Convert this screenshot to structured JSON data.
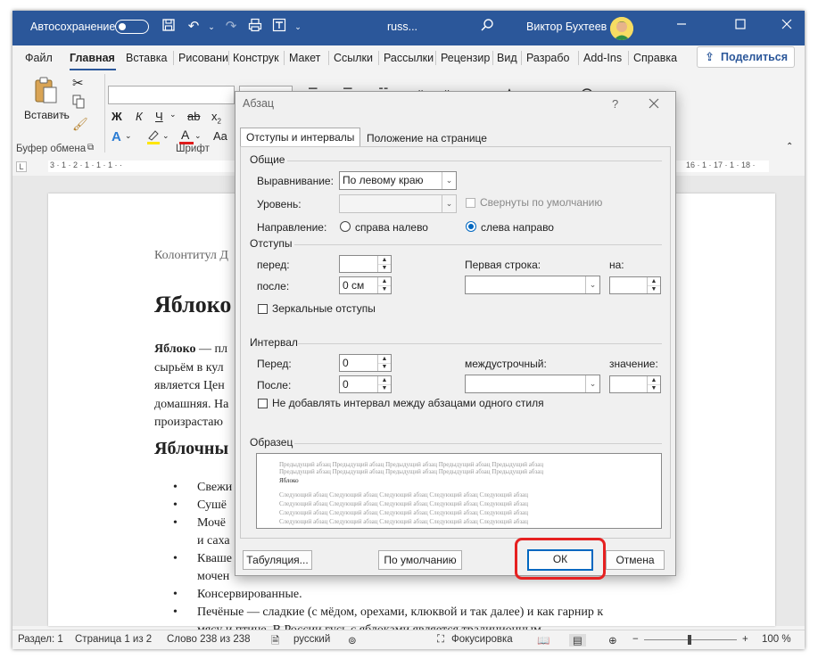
{
  "titlebar": {
    "autosave_label": "Автосохранение",
    "doc_name": "russ...",
    "user_name": "Виктор Бухтеев"
  },
  "tabs": [
    "Файл",
    "Главная",
    "Вставка",
    "Рисовани",
    "Конструк",
    "Макет",
    "Ссылки",
    "Рассылки",
    "Рецензир",
    "Вид",
    "Разрабо",
    "Add-Ins",
    "Справка"
  ],
  "share_label": "Поделиться",
  "ribbon": {
    "paste_label": "Вставить",
    "clipboard_group": "Буфер обмена",
    "font_group": "Шрифт",
    "bold": "Ж",
    "italic": "К",
    "underline": "Ч",
    "strike": "ab",
    "subscript": "x",
    "sub_digit": "2",
    "font_color_glyph": "A",
    "font_size_glyph": "Aa"
  },
  "ruler": {
    "left_ticks": "3 · 1 · 2 · 1 · 1 · 1 · ·",
    "right_ticks": "16 · 1 · 17 · 1 · 18 ·"
  },
  "document": {
    "header_text": "Колонтитул Д",
    "title": "Яблоко",
    "para1_bold": "Яблоко",
    "para1_rest": " — пл",
    "para1_l2": "сырьём в кул",
    "para1_l3": "является Цен",
    "para1_l4": "домашняя. На",
    "para1_l5": "произрастаю",
    "heading2": "Яблочны",
    "bullets": [
      "Свежи",
      "Сушё",
      "Мочё",
      "и саха",
      "Кваше",
      "мочен",
      "Консервированные.",
      "Печёные — сладкие (с мёдом, орехами, клюквой и так далее) и как гарнир к",
      "мясу и птице. В России гусь с яблоками является традиционным"
    ]
  },
  "statusbar": {
    "section": "Раздел: 1",
    "page": "Страница 1 из 2",
    "words": "Слово 238 из 238",
    "language": "русский",
    "focus": "Фокусировка",
    "zoom": "100 %"
  },
  "dialog": {
    "title": "Абзац",
    "help": "?",
    "tab1": "Отступы и интервалы",
    "tab2": "Положение на странице",
    "general_group": "Общие",
    "alignment_label": "Выравнивание:",
    "alignment_value": "По левому краю",
    "level_label": "Уровень:",
    "level_value": "",
    "collapsed_label": "Свернуты по умолчанию",
    "direction_label": "Направление:",
    "rtl_label": "справа налево",
    "ltr_label": "слева направо",
    "indents_group": "Отступы",
    "before_indent_label": "перед:",
    "before_indent_value": "",
    "after_indent_label": "после:",
    "after_indent_value": "0 см",
    "first_line_label": "Первая строка:",
    "first_line_value": "",
    "on_label": "на:",
    "on_value": "",
    "mirror_label": "Зеркальные отступы",
    "spacing_group": "Интервал",
    "sp_before_label": "Перед:",
    "sp_before_value": "0",
    "sp_after_label": "После:",
    "sp_after_value": "0",
    "line_spacing_label": "междустрочный:",
    "line_spacing_value": "",
    "value_label": "значение:",
    "value_value": "",
    "no_space_label": "Не добавлять интервал между абзацами одного стиля",
    "preview_group": "Образец",
    "preview_prev": "Предыдущий абзац Предыдущий абзац Предыдущий абзац Предыдущий абзац Предыдущий абзац",
    "preview_cur": "Яблоко",
    "preview_next": "Следующий абзац Следующий абзац Следующий абзац Следующий абзац Следующий абзац",
    "tabs_button": "Табуляция...",
    "default_button": "По умолчанию",
    "ok_button": "ОК",
    "cancel_button": "Отмена"
  }
}
